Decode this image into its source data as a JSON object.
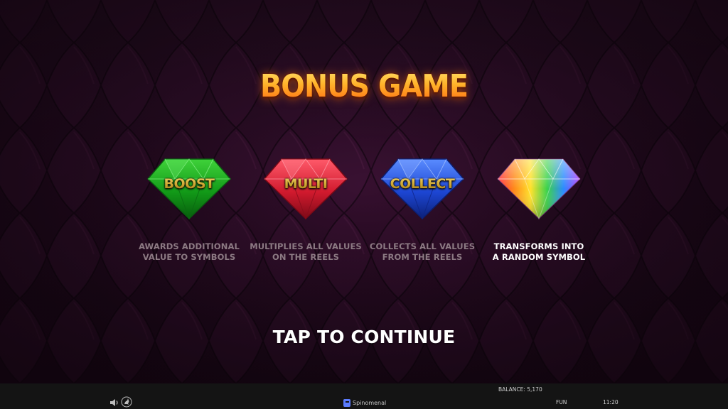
{
  "title": "BONUS GAME",
  "gems": [
    {
      "label": "BOOST",
      "color": "green",
      "description": [
        "AWARDS ADDITIONAL",
        "VALUE TO SYMBOLS"
      ]
    },
    {
      "label": "MULTI",
      "color": "red",
      "description": [
        "MULTIPLIES ALL VALUES",
        "ON THE REELS"
      ]
    },
    {
      "label": "COLLECT",
      "color": "blue",
      "description": [
        "COLLECTS ALL VALUES",
        "FROM THE REELS"
      ]
    },
    {
      "label": "",
      "color": "rainbow",
      "description": [
        "TRANSFORMS INTO",
        "A RANDOM SYMBOL"
      ]
    }
  ],
  "tap_to_continue": "TAP TO CONTINUE",
  "bottom_bar": {
    "brand": "Spinomenal",
    "balance": "BALANCE: 5,170",
    "mode": "FUN",
    "time": "11:20",
    "sound_icon": "speaker-icon",
    "turbo_icon": "rabbit-icon"
  },
  "colors": {
    "background": "#23091f",
    "title_gradient": [
      "#ffe36a",
      "#ff6a12"
    ],
    "desc_text": "#8c7a83",
    "bar": "#141414"
  }
}
